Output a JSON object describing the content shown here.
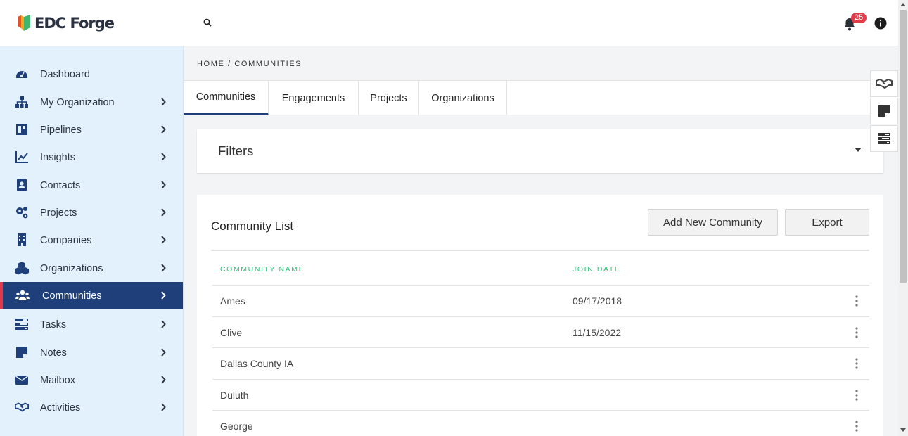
{
  "app": {
    "name": "EDC Forge"
  },
  "header": {
    "notification_count": "25"
  },
  "sidebar": {
    "items": [
      {
        "label": "Dashboard",
        "icon": "dashboard-icon",
        "has_chevron": false
      },
      {
        "label": "My Organization",
        "icon": "org-chart-icon",
        "has_chevron": true
      },
      {
        "label": "Pipelines",
        "icon": "pipelines-icon",
        "has_chevron": true
      },
      {
        "label": "Insights",
        "icon": "chart-line-icon",
        "has_chevron": true
      },
      {
        "label": "Contacts",
        "icon": "contacts-icon",
        "has_chevron": true
      },
      {
        "label": "Projects",
        "icon": "gears-icon",
        "has_chevron": true
      },
      {
        "label": "Companies",
        "icon": "building-icon",
        "has_chevron": true
      },
      {
        "label": "Organizations",
        "icon": "cubes-icon",
        "has_chevron": true
      },
      {
        "label": "Communities",
        "icon": "users-icon",
        "has_chevron": true,
        "active": true
      },
      {
        "label": "Tasks",
        "icon": "tasks-icon",
        "has_chevron": true
      },
      {
        "label": "Notes",
        "icon": "note-icon",
        "has_chevron": true
      },
      {
        "label": "Mailbox",
        "icon": "envelope-icon",
        "has_chevron": true
      },
      {
        "label": "Activities",
        "icon": "handshake-icon",
        "has_chevron": true
      }
    ]
  },
  "breadcrumb": "HOME / COMMUNITIES",
  "tabs": [
    {
      "label": "Communities",
      "active": true
    },
    {
      "label": "Engagements"
    },
    {
      "label": "Projects"
    },
    {
      "label": "Organizations"
    }
  ],
  "filters": {
    "title": "Filters"
  },
  "community_list": {
    "title": "Community List",
    "add_button": "Add New Community",
    "export_button": "Export",
    "columns": [
      "COMMUNITY NAME",
      "JOIN DATE"
    ],
    "rows": [
      {
        "name": "Ames",
        "join_date": "09/17/2018"
      },
      {
        "name": "Clive",
        "join_date": "11/15/2022"
      },
      {
        "name": "Dallas County IA",
        "join_date": ""
      },
      {
        "name": "Duluth",
        "join_date": ""
      },
      {
        "name": "George",
        "join_date": ""
      }
    ]
  },
  "colors": {
    "sidebar_bg": "#e3f1fc",
    "active_nav_bg": "#1e3f7a",
    "active_nav_accent": "#e0394b",
    "table_header": "#2fc27a",
    "badge": "#e23b4a"
  }
}
